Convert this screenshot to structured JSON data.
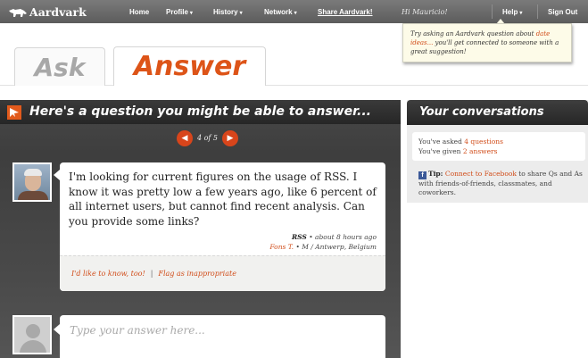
{
  "topbar": {
    "brand": "Aardvark",
    "nav": {
      "home": "Home",
      "profile": "Profile",
      "history": "History",
      "network": "Network",
      "share": "Share Aardvark!",
      "help": "Help",
      "sign_out": "Sign Out"
    },
    "caret": "▾",
    "greeting": "Hi Mauricio!"
  },
  "tooltip": {
    "pre": "Try asking an Aardvark question about ",
    "link": "date ideas...",
    "post": " you'll get connected to someone with a great suggestion!"
  },
  "tabs": {
    "ask": "Ask",
    "answer": "Answer"
  },
  "question_panel": {
    "heading": "Here's a question you might be able to answer...",
    "pager": {
      "prev": "◀",
      "next": "▶",
      "text": "4 of 5"
    },
    "question": "I'm looking for current figures on the usage of RSS. I know it was pretty low a few years ago, like 6 percent of all internet users, but cannot find recent analysis. Can you provide some links?",
    "topic": "RSS",
    "time": " • about 8 hours ago",
    "asker": "Fons T.",
    "asker_info": " • M / Antwerp, Belgium",
    "like_link": "I'd like to know, too!",
    "separator": "|",
    "flag_link": "Flag as inappropriate",
    "answer_placeholder": "Type your answer here..."
  },
  "conversations": {
    "heading": "Your conversations",
    "asked_pre": "You've asked ",
    "asked_link": "4 questions",
    "given_pre": "You've given ",
    "given_link": "2 answers",
    "tip_icon": "f",
    "tip_label": "Tip:",
    "tip_link": "Connect to Facebook",
    "tip_text": " to share Qs and As with friends-of-friends, classmates, and coworkers."
  },
  "colors": {
    "accent": "#dd5418",
    "link": "#d14d1a",
    "bar": "#666666",
    "facebook": "#3b5998"
  }
}
